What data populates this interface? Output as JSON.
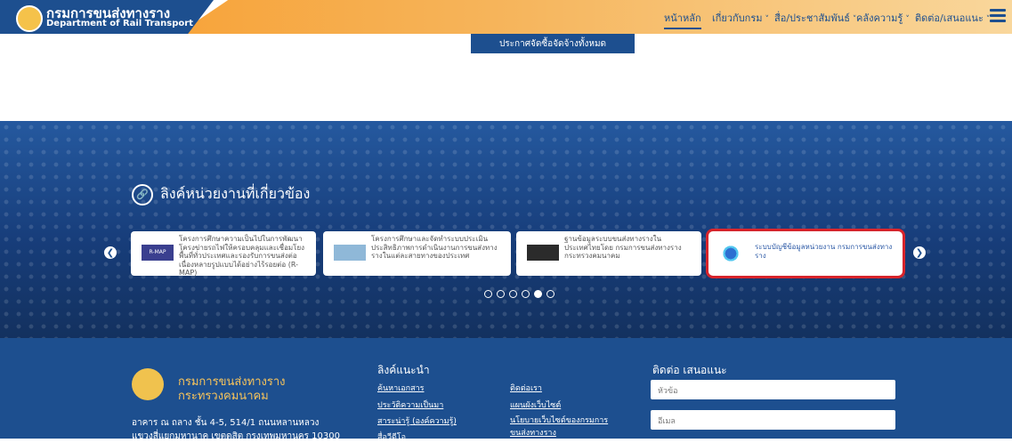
{
  "header": {
    "brand_th": "กรมการขนส่งทางราง",
    "brand_en": "Department of Rail Transport",
    "nav": [
      {
        "label": "หน้าหลัก",
        "active": true
      },
      {
        "label": "เกี่ยวกับกรม",
        "caret": "˅"
      },
      {
        "label": "สื่อ/ประชาสัมพันธ์",
        "caret": "˅"
      },
      {
        "label": "คลังความรู้",
        "caret": "˅"
      },
      {
        "label": "ติดต่อ/เสนอแนะ",
        "caret": "˅"
      }
    ],
    "menu_icon": "hamburger-icon"
  },
  "procurement_button": "ประกาศจัดซื้อจัดจ้างทั้งหมด",
  "related_links": {
    "title": "ลิงค์หน่วยงานที่เกี่ยวข้อง",
    "title_icon": "link-icon",
    "prev_icon": "chevron-left-icon",
    "next_icon": "chevron-right-icon",
    "cards": [
      {
        "text": "โครงการศึกษาความเป็นไปในการพัฒนาโครงข่ายรถไฟให้ครอบคลุมและเชื่อมโยงพื้นที่ทั่วประเทศและรองรับการขนส่งต่อเนื่องหลายรูปแบบได้อย่างไร้รอยต่อ (R-MAP)",
        "thumb_label": "R-MAP"
      },
      {
        "text": "โครงการศึกษาและจัดทำระบบประเมินประสิทธิภาพการดำเนินงานการขนส่งทางรางในแต่ละสายทางของประเทศ"
      },
      {
        "text": "ฐานข้อมูลระบบขนส่งทางรางในประเทศไทยโดย กรมการขนส่งทางราง กระทรวงคมนาคม"
      },
      {
        "text": "ระบบบัญชีข้อมูลหน่วยงาน กรมการขนส่งทางราง",
        "highlighted": true
      }
    ],
    "pager_total": 6,
    "pager_active": 5
  },
  "footer": {
    "org_name_1": "กรมการขนส่งทางราง",
    "org_name_2": "กระทรวงคมนาคม",
    "address_1": "อาคาร ณ ถลาง ชั้น 4-5, 514/1 ถนนหลานหลวง",
    "address_2": "แขวงสี่แยกมหานาค เขตดุสิต กรุงเทพมหานคร 10300",
    "recommended_heading": "ลิงค์แนะนำ",
    "links_col1": [
      "ค้นหาเอกสาร",
      "ประวัติความเป็นมา",
      "สาระน่ารู้ (องค์ความรู้)",
      "สื่อวีดีโอ"
    ],
    "links_col2": [
      "ติดต่อเรา",
      "แผนผังเว็บไซต์",
      "นโยบายเว็บไซต์ของกรมการขนส่งทางราง"
    ],
    "contact_heading": "ติดต่อ เสนอแนะ",
    "subject_placeholder": "หัวข้อ",
    "email_placeholder": "อีเมล"
  }
}
